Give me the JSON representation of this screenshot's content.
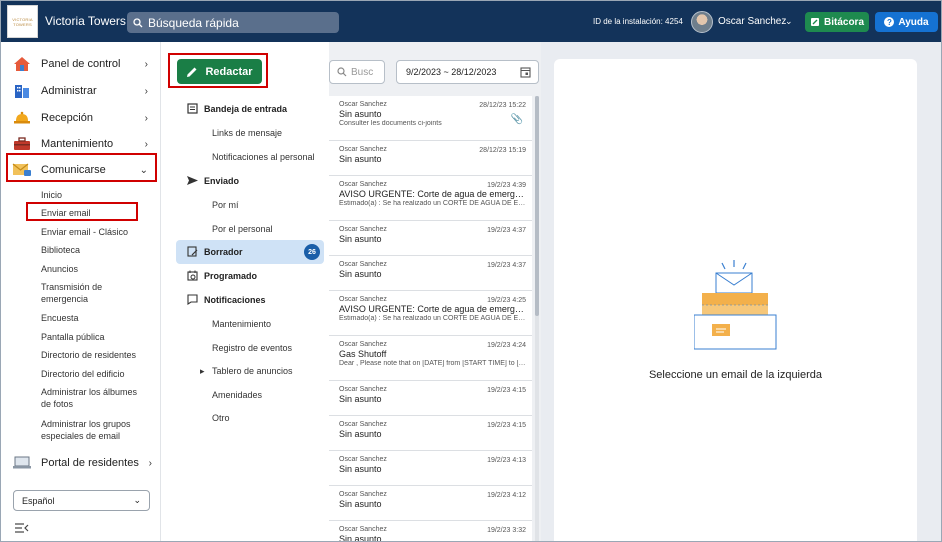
{
  "header": {
    "logo_text": [
      "VICTORIA",
      "TOWERS"
    ],
    "app_title": "Victoria Towers",
    "search_placeholder": "Búsqueda rápida",
    "install_id": "ID de la instalación: 4254",
    "user_name": "Oscar Sanchez",
    "bitacora_label": "Bitácora",
    "ayuda_label": "Ayuda"
  },
  "sidebar": {
    "items": [
      {
        "label": "Panel de control",
        "icon": "home-icon"
      },
      {
        "label": "Administrar",
        "icon": "building-icon"
      },
      {
        "label": "Recepción",
        "icon": "bell-icon"
      },
      {
        "label": "Mantenimiento",
        "icon": "toolbox-icon"
      },
      {
        "label": "Comunicarse",
        "icon": "envelope-icon"
      }
    ],
    "sub_items": [
      "Inicio",
      "Enviar email",
      "Enviar email - Clásico",
      "Biblioteca",
      "Anuncios",
      "Transmisión de emergencia",
      "Encuesta",
      "Pantalla pública",
      "Directorio de residentes",
      "Directorio del edificio",
      "Administrar los álbumes de fotos",
      "Administrar los grupos especiales de email"
    ],
    "portal_label": "Portal de residentes",
    "language": "Español"
  },
  "folders": {
    "compose_label": "Redactar",
    "inbox": "Bandeja de entrada",
    "inbox_subs": [
      "Links de mensaje",
      "Notificaciones al personal"
    ],
    "sent": "Enviado",
    "sent_subs": [
      "Por mí",
      "Por el personal"
    ],
    "draft": "Borrador",
    "draft_count": "26",
    "scheduled": "Programado",
    "notifications": "Notificaciones",
    "notif_subs": [
      "Mantenimiento",
      "Registro de eventos",
      "Tablero de anuncios",
      "Amenidades",
      "Otro"
    ]
  },
  "list": {
    "search_placeholder": "Busc",
    "date_range": "9/2/2023 ~ 28/12/2023",
    "emails": [
      {
        "from": "Oscar Sanchez",
        "date": "28/12/23 15:22",
        "subject": "Sin asunto",
        "preview": "Consulter les documents ci-joints",
        "attachment": true
      },
      {
        "from": "Oscar Sanchez",
        "date": "28/12/23 15:19",
        "subject": "Sin asunto",
        "preview": ""
      },
      {
        "from": "Oscar Sanchez",
        "date": "19/2/23 4:39",
        "subject": "AVISO URGENTE: Corte de agua de emergencia",
        "preview": "Estimado(a) : Se ha realizado un CORTE DE AGUA DE EMERGENCIA"
      },
      {
        "from": "Oscar Sanchez",
        "date": "19/2/23 4:37",
        "subject": "Sin asunto",
        "preview": ""
      },
      {
        "from": "Oscar Sanchez",
        "date": "19/2/23 4:37",
        "subject": "Sin asunto",
        "preview": ""
      },
      {
        "from": "Oscar Sanchez",
        "date": "19/2/23 4:25",
        "subject": "AVISO URGENTE: Corte de agua de emergencia",
        "preview": "Estimado(a) : Se ha realizado un CORTE DE AGUA DE EMERGENCIA"
      },
      {
        "from": "Oscar Sanchez",
        "date": "19/2/23 4:24",
        "subject": "Gas Shutoff",
        "preview": "Dear , Please note that on [DATE] from [START TIME] to [END TIME]"
      },
      {
        "from": "Oscar Sanchez",
        "date": "19/2/23 4:15",
        "subject": "Sin asunto",
        "preview": ""
      },
      {
        "from": "Oscar Sanchez",
        "date": "19/2/23 4:15",
        "subject": "Sin asunto",
        "preview": ""
      },
      {
        "from": "Oscar Sanchez",
        "date": "19/2/23 4:13",
        "subject": "Sin asunto",
        "preview": ""
      },
      {
        "from": "Oscar Sanchez",
        "date": "19/2/23 4:12",
        "subject": "Sin asunto",
        "preview": ""
      },
      {
        "from": "Oscar Sanchez",
        "date": "19/2/23 3:32",
        "subject": "Sin asunto",
        "preview": ""
      }
    ]
  },
  "preview": {
    "empty_message": "Seleccione un email de la izquierda"
  },
  "colors": {
    "topbar": "#13335a",
    "compose": "#1a7e46",
    "bitacora": "#1e8a4f",
    "ayuda": "#1572d3",
    "highlight_box": "#d00000",
    "selected_folder": "#cfe2f6"
  }
}
